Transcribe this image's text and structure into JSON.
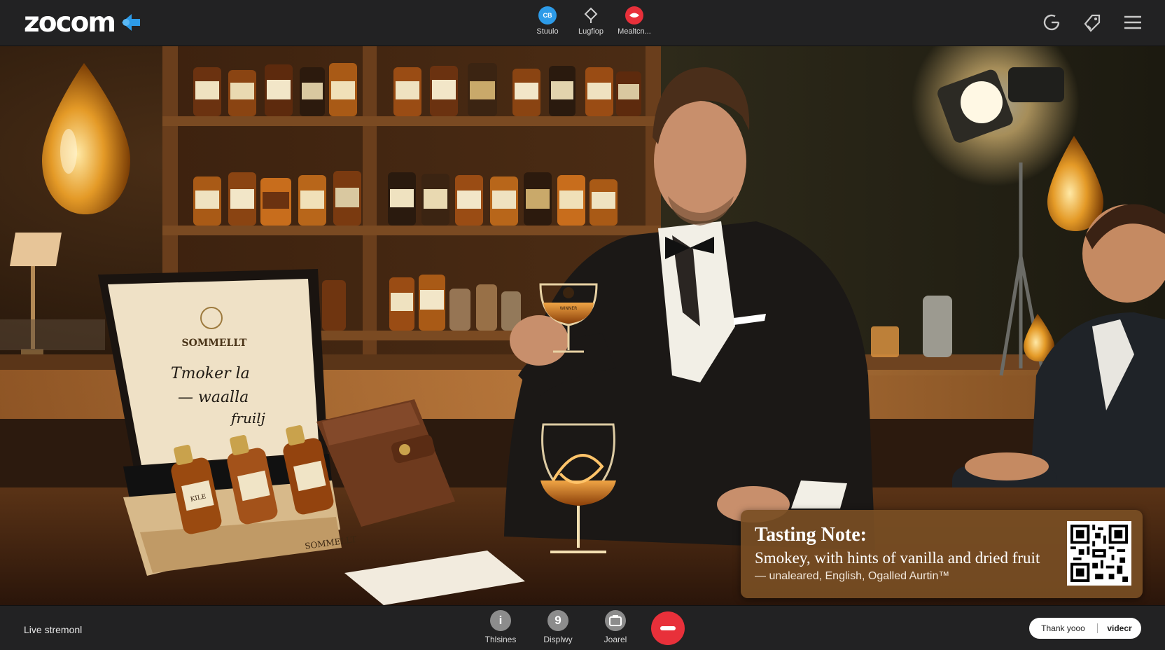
{
  "app": {
    "logo_text": "zocom",
    "accent": "#2d9be8",
    "end_color": "#e8303a"
  },
  "top_center": [
    {
      "label": "Stuulo",
      "icon": "cb-badge-icon",
      "badge": "CB",
      "color": "#2d9be8"
    },
    {
      "label": "Lugfiop",
      "icon": "diamond-pin-icon",
      "color": "#cfcfcf"
    },
    {
      "label": "Mealtcn...",
      "icon": "lips-icon",
      "color": "#e8303a"
    }
  ],
  "top_right": [
    "refresh-icon",
    "tag-edit-icon",
    "hamburger-menu-icon"
  ],
  "scene": {
    "box_brand": "SOMMELLT",
    "box_handwriting_1": "Tmoker la",
    "box_handwriting_2": "— waalla",
    "box_handwriting_3": "fruilj",
    "box_front": "SOMMELLT",
    "bottle_label": "KILE",
    "glass_label": "WINNER"
  },
  "tasting_note": {
    "title": "Tasting Note:",
    "body": "Smokey, with hints of vanilla and dried fruit",
    "sub": "— unaleared, English, Ogalled Aurtin™"
  },
  "bottom": {
    "live_label": "Live stremonl",
    "controls": [
      {
        "label": "Thlsines",
        "glyph": "i",
        "icon": "info-icon"
      },
      {
        "label": "Displwy",
        "glyph": "9",
        "icon": "display-icon"
      },
      {
        "label": "Joarel",
        "glyph": "",
        "icon": "share-screen-icon"
      }
    ],
    "pill_left": "Thank yooo",
    "pill_right": "videcr"
  }
}
